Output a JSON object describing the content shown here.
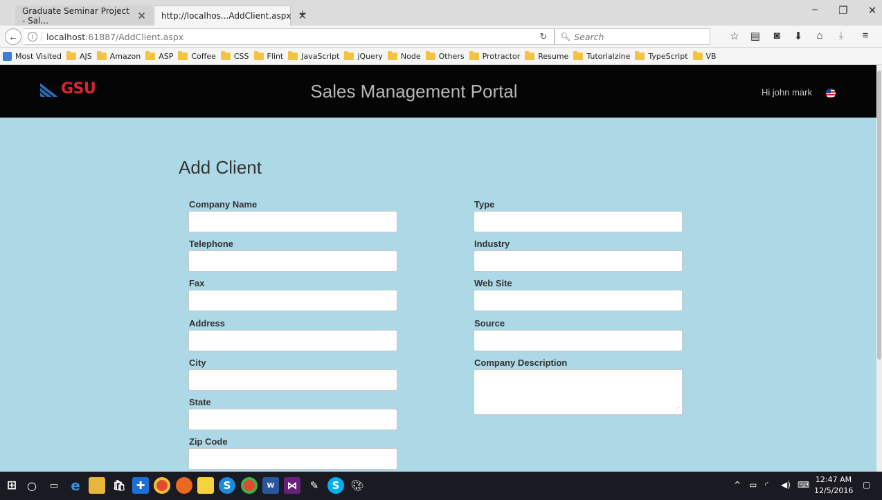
{
  "browser": {
    "tabs": [
      {
        "title": "Graduate Seminar Project - Sal...",
        "active": false
      },
      {
        "title": "http://localhos...AddClient.aspx",
        "active": true
      }
    ],
    "url_host": "localhost",
    "url_rest": ":61887/AddClient.aspx",
    "search_placeholder": "Search",
    "bookmarks": [
      "Most Visited",
      "AJS",
      "Amazon",
      "ASP",
      "Coffee",
      "CSS",
      "Flint",
      "JavaScript",
      "jQuery",
      "Node",
      "Others",
      "Protractor",
      "Resume",
      "Tutorialzine",
      "TypeScript",
      "VB"
    ]
  },
  "header": {
    "logo_text": "GSU",
    "title": "Sales Management Portal",
    "greeting": "Hi john mark"
  },
  "form": {
    "heading": "Add Client",
    "left_fields": [
      {
        "label": "Company Name",
        "value": ""
      },
      {
        "label": "Telephone",
        "value": ""
      },
      {
        "label": "Fax",
        "value": ""
      },
      {
        "label": "Address",
        "value": ""
      },
      {
        "label": "City",
        "value": ""
      },
      {
        "label": "State",
        "value": ""
      },
      {
        "label": "Zip Code",
        "value": ""
      }
    ],
    "right_fields": [
      {
        "label": "Type",
        "value": ""
      },
      {
        "label": "Industry",
        "value": ""
      },
      {
        "label": "Web Site",
        "value": ""
      },
      {
        "label": "Source",
        "value": ""
      },
      {
        "label": "Company Description",
        "value": ""
      }
    ]
  },
  "taskbar": {
    "apps": [
      "windows-start",
      "cortana-search",
      "task-view",
      "edge",
      "file-explorer",
      "store",
      "defender",
      "chrome",
      "firefox",
      "sticky-notes",
      "skype-business",
      "chrome-2",
      "word",
      "visual-studio",
      "paint-app",
      "skype",
      "paint"
    ],
    "time": "12:47 AM",
    "date": "12/5/2016"
  },
  "colors": {
    "page_bg": "#add8e6",
    "header_bg": "#050505",
    "logo_red": "#d9262e",
    "logo_blue": "#2b6cb8"
  }
}
